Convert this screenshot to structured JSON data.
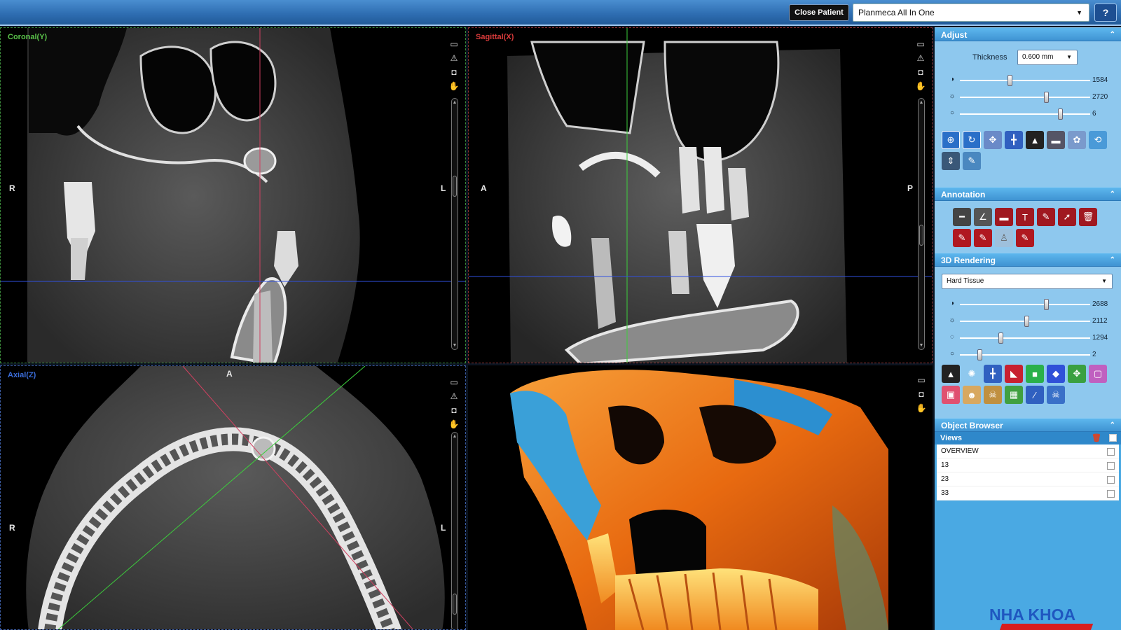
{
  "topbar": {
    "close_patient_label": "Close Patient",
    "device_selected": "Planmeca All In One",
    "help_label": "?"
  },
  "viewports": {
    "coronal": {
      "label": "Coronal(Y)",
      "label_color": "#5ac34a",
      "left": "R",
      "right": "L"
    },
    "sagittal": {
      "label": "Sagittal(X)",
      "label_color": "#d83a3a",
      "left": "A",
      "right": "P"
    },
    "axial": {
      "label": "Axial(Z)",
      "label_color": "#3a6cd8",
      "top": "A",
      "left": "R",
      "right": "L"
    }
  },
  "panel": {
    "adjust": {
      "title": "Adjust",
      "thickness_label": "Thickness",
      "thickness_value": "0.600 mm",
      "sliders": [
        {
          "icon": "contrast-icon",
          "glyph": "◑",
          "value": "1584",
          "position": 0.38
        },
        {
          "icon": "brightness-icon",
          "glyph": "☼",
          "value": "2720",
          "position": 0.66
        },
        {
          "icon": "gamma-icon",
          "glyph": "○",
          "value": "6",
          "position": 0.77
        }
      ]
    },
    "annotation": {
      "title": "Annotation"
    },
    "rendering": {
      "title": "3D Rendering",
      "preset": "Hard Tissue",
      "sliders": [
        {
          "icon": "contrast-icon",
          "glyph": "◑",
          "value": "2688",
          "position": 0.66
        },
        {
          "icon": "brightness-icon",
          "glyph": "☼",
          "value": "2112",
          "position": 0.51
        },
        {
          "icon": "opacity-icon",
          "glyph": "◌",
          "value": "1294",
          "position": 0.31
        },
        {
          "icon": "gamma-icon",
          "glyph": "○",
          "value": "2",
          "position": 0.15
        }
      ]
    },
    "object_browser": {
      "title": "Object Browser",
      "views_label": "Views",
      "views": [
        "OVERVIEW",
        "13",
        "23",
        "33"
      ]
    },
    "brand": "NHA KHOA"
  },
  "colors": {
    "panel_bg": "#4aa9e3",
    "header_blue": "#2d6cb0",
    "crosshair_green": "#3ccf3c",
    "crosshair_red": "#d04060",
    "crosshair_blue": "#3050e0"
  }
}
